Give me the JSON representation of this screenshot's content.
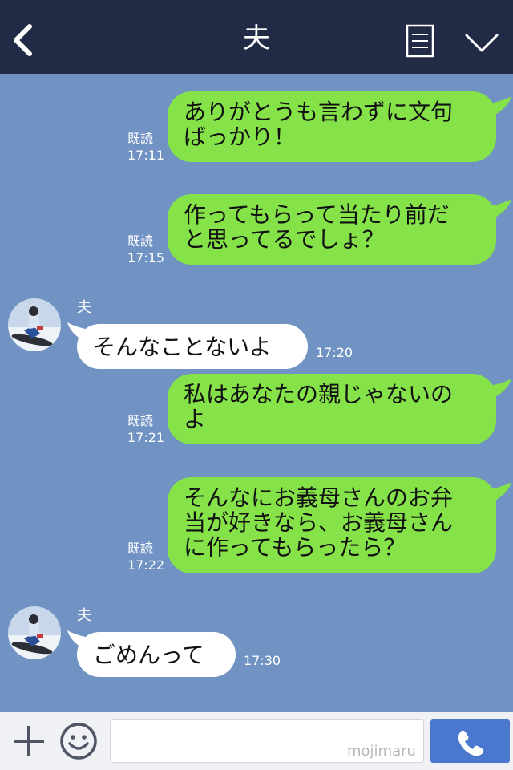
{
  "header": {
    "title": "夫",
    "back_icon": "chevron-left-icon",
    "menu_icon": "menu-list-icon",
    "collapse_icon": "chevron-down-icon",
    "background": "#222b45"
  },
  "chat": {
    "background": "#7193c3",
    "outgoing_bubble_color": "#85e249",
    "incoming_bubble_color": "#ffffff",
    "messages": [
      {
        "direction": "out",
        "lines": [
          "ありがとうも言わずに文句",
          "ばっかり！"
        ],
        "read": "既読",
        "time": "17:11"
      },
      {
        "direction": "out",
        "lines": [
          "作ってもらって当たり前だ",
          "と思ってるでしょ？"
        ],
        "read": "既読",
        "time": "17:15"
      },
      {
        "direction": "in",
        "sender": "夫",
        "text": "そんなことないよ",
        "time": "17:20"
      },
      {
        "direction": "out",
        "lines": [
          "私はあなたの親じゃないの",
          "よ"
        ],
        "read": "既読",
        "time": "17:21"
      },
      {
        "direction": "out",
        "lines": [
          "そんなにお義母さんのお弁",
          "当が好きなら、お義母さん",
          "に作ってもらったら？"
        ],
        "read": "既読",
        "time": "17:22"
      },
      {
        "direction": "in",
        "sender": "夫",
        "text": "ごめんって",
        "time": "17:30"
      }
    ]
  },
  "footer": {
    "plus_icon": "plus-icon",
    "emoji_icon": "smiley-icon",
    "input_value": "",
    "watermark": "mojimaru",
    "call_icon": "phone-icon",
    "call_button_color": "#4a78cf"
  }
}
